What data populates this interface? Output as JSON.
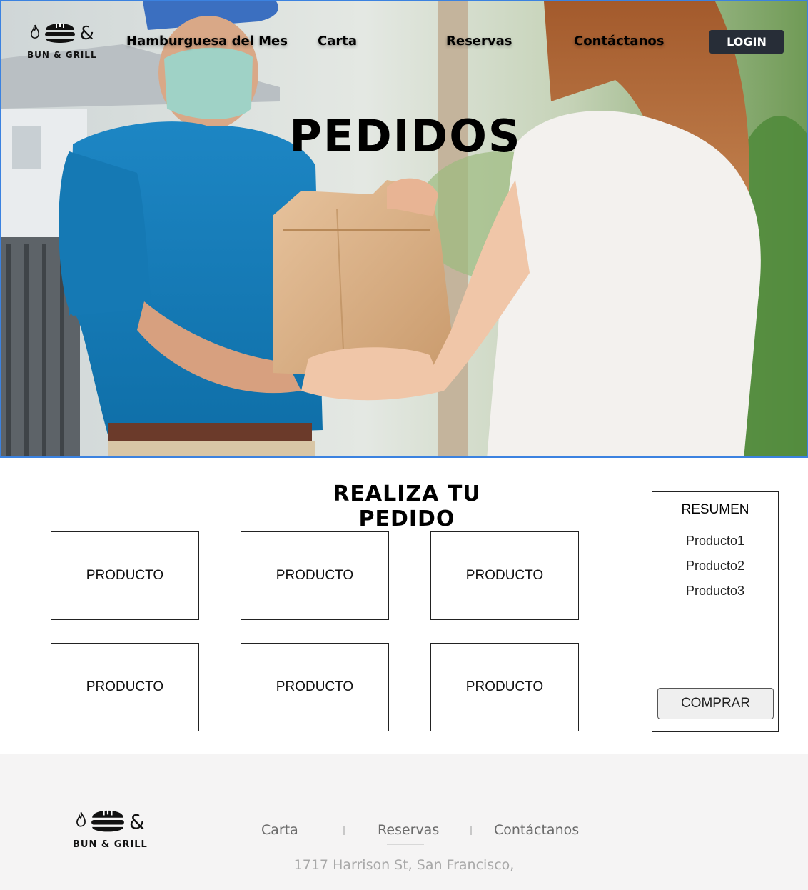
{
  "header": {
    "logo": {
      "ampersand": "&",
      "wordmark": "BUN & GRILL",
      "icon": "burger-icon"
    },
    "nav": [
      {
        "label": "Hamburguesa del Mes"
      },
      {
        "label": "Carta"
      },
      {
        "label": "Reservas"
      },
      {
        "label": "Contáctanos"
      }
    ],
    "login_label": "LOGIN"
  },
  "hero": {
    "title": "PEDIDOS"
  },
  "order": {
    "title": "REALIZA TU PEDIDO",
    "products": [
      {
        "label": "PRODUCTO"
      },
      {
        "label": "PRODUCTO"
      },
      {
        "label": "PRODUCTO"
      },
      {
        "label": "PRODUCTO"
      },
      {
        "label": "PRODUCTO"
      },
      {
        "label": "PRODUCTO"
      }
    ]
  },
  "summary": {
    "title": "RESUMEN",
    "items": [
      "Producto1",
      "Producto2",
      "Producto3"
    ],
    "buy_label": "COMPRAR"
  },
  "footer": {
    "logo": {
      "ampersand": "&",
      "wordmark": "BUN & GRILL",
      "icon": "burger-icon"
    },
    "links": [
      {
        "label": "Carta"
      },
      {
        "label": "Reservas"
      },
      {
        "label": "Contáctanos"
      }
    ],
    "address": "1717 Harrison St, San Francisco,"
  },
  "colors": {
    "accent_border": "#3b82e0",
    "login_bg": "#272d37",
    "footer_bg": "#f5f4f4"
  }
}
